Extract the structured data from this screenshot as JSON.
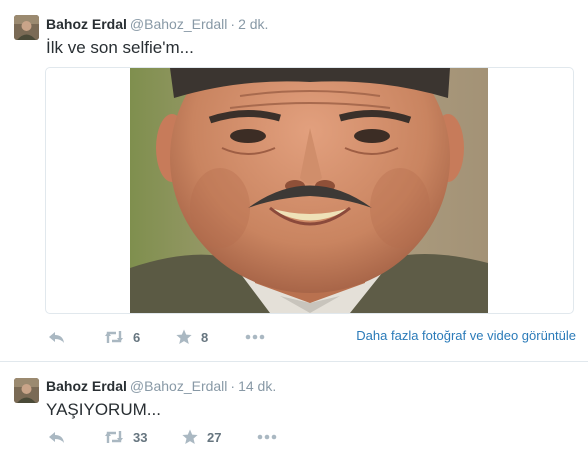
{
  "tweets": [
    {
      "name": "Bahoz Erdal",
      "handle": "@Bahoz_Erdall",
      "separator": "·",
      "time": "2 dk.",
      "text": "İlk ve son selfie'm...",
      "retweets": "6",
      "favorites": "8",
      "media_link": "Daha fazla fotoğraf ve video görüntüle"
    },
    {
      "name": "Bahoz Erdal",
      "handle": "@Bahoz_Erdall",
      "separator": "·",
      "time": "14 dk.",
      "text": "YAŞIYORUM...",
      "retweets": "33",
      "favorites": "27"
    }
  ],
  "icons": {
    "reply": "reply-icon",
    "retweet": "retweet-icon",
    "favorite": "star-icon",
    "more": "more-icon"
  },
  "colors": {
    "name": "#292f33",
    "meta": "#8899a6",
    "action": "#aab8c2",
    "link": "#2b7bb9",
    "divider": "#e1e8ed"
  }
}
